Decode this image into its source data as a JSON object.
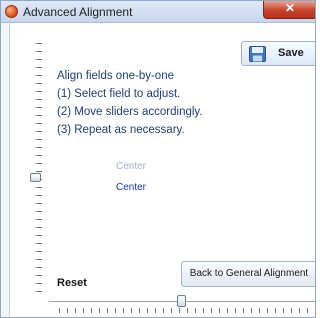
{
  "window": {
    "title": "Advanced Alignment",
    "close_glyph": "✕"
  },
  "toolbar": {
    "save_label": "Save",
    "save_icon": "floppy-disk-icon",
    "dropdown_icon": "chevron-down-icon"
  },
  "instructions": [
    "Align fields one-by-one",
    "(1) Select field to adjust.",
    "(2) Move sliders accordingly.",
    "(3) Repeat as necessary."
  ],
  "fields": {
    "faded_label": "Center",
    "active_label": "Center"
  },
  "reset_label": "Reset",
  "back_button_label": "Back to General Alignment",
  "colors": {
    "instruction_text": "#1e3f74",
    "active_field": "#1b2fb5",
    "faded_field": "#9fb0c8",
    "close_button": "#c7422b"
  }
}
